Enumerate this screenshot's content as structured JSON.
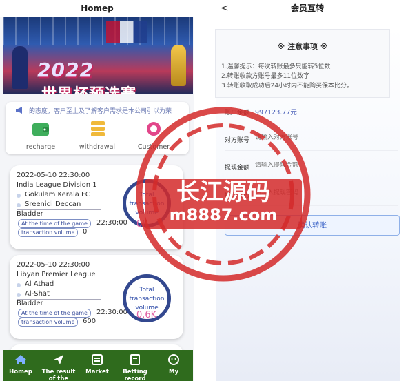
{
  "left": {
    "title": "Homep",
    "banner": {
      "year": "2022",
      "title": "世界杯预选赛"
    },
    "notice_text": "的态度，客户至上及了解客户需求是本公司引以为荣",
    "quick_actions": [
      {
        "label": "recharge",
        "icon": "wallet-icon"
      },
      {
        "label": "withdrawal",
        "icon": "coin-stack-icon"
      },
      {
        "label": "Customer",
        "icon": "headset-icon"
      }
    ],
    "matches": [
      {
        "datetime": "2022-05-10 22:30:00",
        "league": "India League Division 1",
        "team1": "Gokulam Kerala FC",
        "team2": "Sreenidi Deccan",
        "player": "Bladder",
        "pill1": "At the time of the game",
        "time": "22:30:00",
        "pill2": "transaction volume",
        "volume": "0",
        "ring_text": "Total transaction volume",
        "ring_value": "0K"
      },
      {
        "datetime": "2022-05-10 22:30:00",
        "league": "Libyan Premier League",
        "team1": "Al Athad",
        "team2": "Al-Shat",
        "player": "Bladder",
        "pill1": "At the time of the game",
        "time": "22:30:00",
        "pill2": "transaction volume",
        "volume": "600",
        "ring_text": "Total transaction volume",
        "ring_value": "0.6K"
      }
    ],
    "tabs": [
      {
        "label": "Homep",
        "icon": "home-icon"
      },
      {
        "label": "The result of the competition",
        "icon": "send-icon"
      },
      {
        "label": "Market",
        "icon": "market-icon"
      },
      {
        "label": "Betting record",
        "icon": "record-icon"
      },
      {
        "label": "My",
        "icon": "face-icon"
      }
    ]
  },
  "right": {
    "title": "会员互转",
    "back": "<",
    "notice": {
      "title": "※ 注意事项 ※",
      "lines": [
        "1.温馨提示：每次转账最多只能转5位数",
        "2.转账收款方账号最多11位数字",
        "3.转账收取成功后24小时内不能购买保本比分。"
      ]
    },
    "balance_label": "账户余额",
    "balance_value": "997123.77元",
    "account_label": "对方账号",
    "account_placeholder": "请输入对方账号",
    "amount_label": "提现金额",
    "amount_placeholder": "请输入提现金额",
    "pwd_label": "提现密码",
    "pwd_placeholder": "请输入提现密码",
    "confirm_label": "确认转账"
  },
  "watermark": {
    "name": "长江源码",
    "url": "m8887.com"
  },
  "colors": {
    "tabbar": "#2f6b1d",
    "stamp": "#d42a2a",
    "accent": "#3a63c8"
  }
}
